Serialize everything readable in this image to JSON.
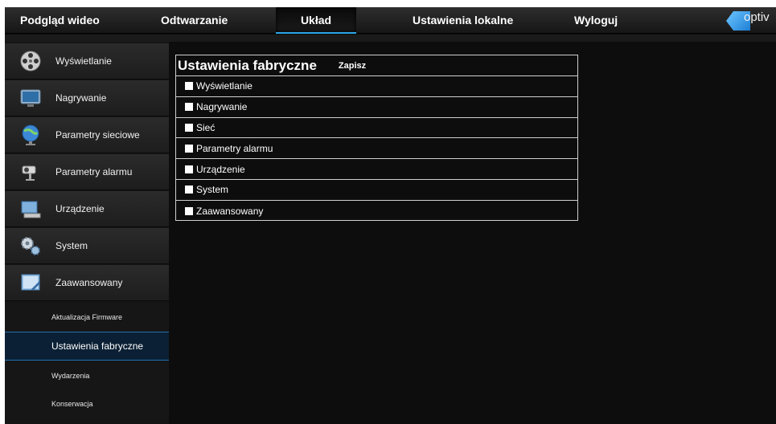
{
  "nav": {
    "items": [
      "Podgląd wideo",
      "Odtwarzanie",
      "Układ",
      "Ustawienia lokalne",
      "Wyloguj"
    ],
    "active": "Układ",
    "logo_text": "optiv"
  },
  "sidebar": {
    "items": [
      {
        "label": "Wyświetlanie",
        "icon": "film-reel-icon"
      },
      {
        "label": "Nagrywanie",
        "icon": "monitor-icon"
      },
      {
        "label": "Parametry sieciowe",
        "icon": "globe-icon"
      },
      {
        "label": "Parametry alarmu",
        "icon": "camera-alarm-icon"
      },
      {
        "label": "Urządzenie",
        "icon": "device-icon"
      },
      {
        "label": "System",
        "icon": "gears-icon"
      },
      {
        "label": "Zaawansowany",
        "icon": "advanced-icon"
      }
    ],
    "subitems": [
      "Aktualizacja Firmware",
      "Ustawienia fabryczne",
      "Wydarzenia",
      "Konserwacja"
    ],
    "active_subitem": "Ustawienia fabryczne"
  },
  "panel": {
    "title": "Ustawienia fabryczne",
    "save_label": "Zapisz",
    "options": [
      "Wyświetlanie",
      "Nagrywanie",
      "Sieć",
      "Parametry alarmu",
      "Urządzenie",
      "System",
      "Zaawansowany"
    ]
  },
  "colors": {
    "accent": "#2aa7e8",
    "background": "#0d0d0d"
  }
}
